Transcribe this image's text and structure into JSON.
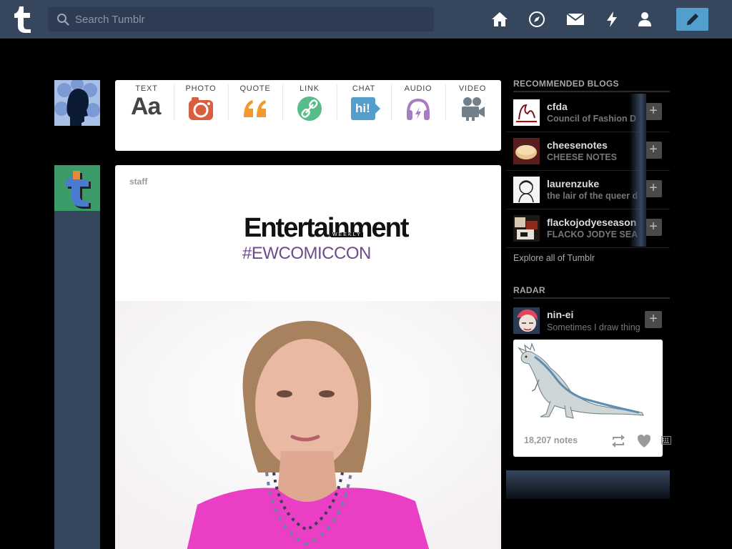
{
  "header": {
    "search_placeholder": "Search Tumblr",
    "nav": [
      "home-icon",
      "explore-icon",
      "inbox-icon",
      "activity-icon",
      "account-icon"
    ],
    "compose": "pencil-icon"
  },
  "post_types": [
    {
      "label": "TEXT",
      "icon": "Aa",
      "color": "#444444"
    },
    {
      "label": "PHOTO",
      "icon": "camera-icon",
      "color": "#d95e40"
    },
    {
      "label": "QUOTE",
      "icon": "quote-icon",
      "color": "#f2992e"
    },
    {
      "label": "LINK",
      "icon": "link-icon",
      "color": "#56bc8a"
    },
    {
      "label": "CHAT",
      "icon": "hi!",
      "color": "#529ecc"
    },
    {
      "label": "AUDIO",
      "icon": "headphones-icon",
      "color": "#a77dc2"
    },
    {
      "label": "VIDEO",
      "icon": "video-camera-icon",
      "color": "#748089"
    }
  ],
  "post": {
    "author": "staff",
    "brand": "Entertainment",
    "brand_sub": "WEEKLY",
    "hashtag": "#EWCOMICCON"
  },
  "sidebar": {
    "recommended_heading": "RECOMMENDED BLOGS",
    "blogs": [
      {
        "name": "cfda",
        "title": "Council of Fashion D"
      },
      {
        "name": "cheesenotes",
        "title": "CHEESE NOTES"
      },
      {
        "name": "laurenzuke",
        "title": "the lair of the queer d"
      },
      {
        "name": "flackojodyeseason",
        "title": "FLACKO JODYE SEA"
      }
    ],
    "follow_label": "+",
    "explore_label": "Explore all of Tumblr",
    "radar_heading": "RADAR",
    "radar": {
      "name": "nin-ei",
      "title": "Sometimes I draw thing",
      "notes": "18,207 notes"
    }
  },
  "colors": {
    "header_bg": "#36465d",
    "accent": "#529ecc",
    "background": "#000000"
  }
}
